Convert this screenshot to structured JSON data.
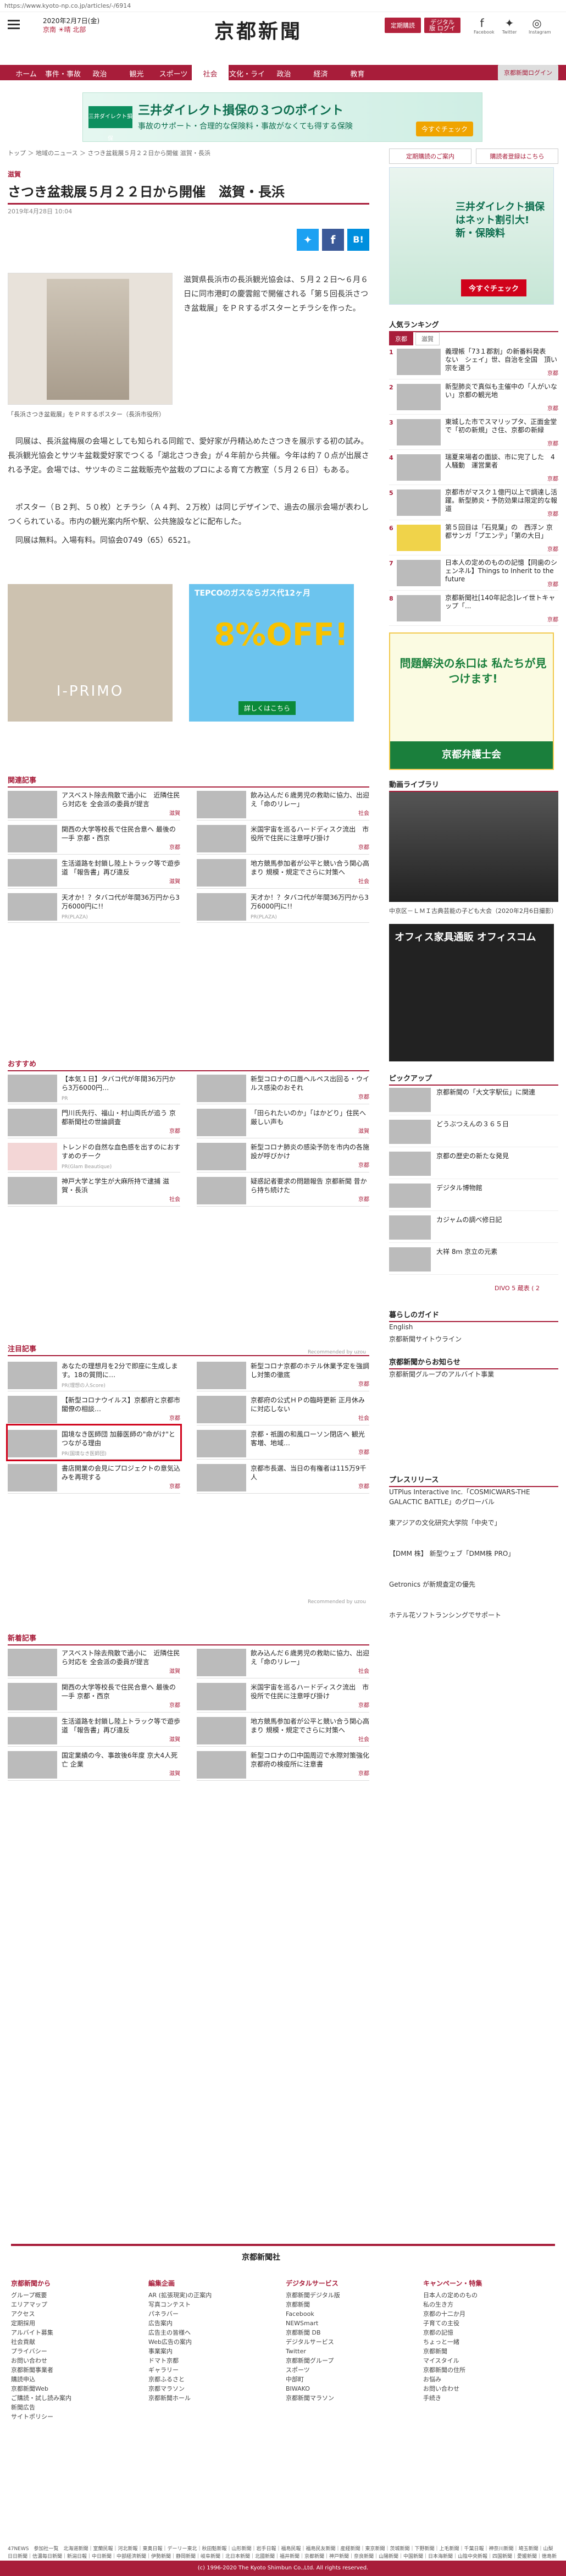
{
  "url": "https://www.kyoto-np.co.jp/articles/-/6914",
  "header": {
    "date": "2020年2月7日(金)",
    "weather1": "京南 ☀晴 北部",
    "logo": "京都新聞",
    "btn_member": "定期購読",
    "btn_digital": "デジタル版 ログイン",
    "social": [
      "Facebook",
      "Twitter",
      "Instagram"
    ]
  },
  "nav": [
    "ホーム",
    "事件・事故",
    "政治",
    "観光",
    "スポーツ",
    "社会",
    "文化・ライフ",
    "政治",
    "経済",
    "教育",
    "京都新聞ログイン"
  ],
  "banner": {
    "logo": "三井ダイレクト損保",
    "title": "三井ダイレクト損保の３つのポイント",
    "sub": "事故のサポート・合理的な保険料・事故がなくても得する保険",
    "cta": "今すぐチェック"
  },
  "article": {
    "crumb": "トップ ＞ 地域のニュース ＞ さつき盆栽展５月２２日から開催 滋賀・長浜",
    "category": "滋賀",
    "title": "さつき盆栽展５月２２日から開催　滋賀・長浜",
    "date": "2019年4月28日 10:04",
    "caption": "「長浜さつき盆栽展」をＰＲするポスター（長浜市役所）",
    "p1": "滋賀県長浜市の長浜観光協会は、５月２２日～６月６日に同市港町の慶雲館で開催される「第５回長浜さつき盆栽展」をＰＲするポスターとチラシを作った。",
    "p2": "同展は、長浜盆梅展の会場としても知られる同館で、愛好家が丹精込めたさつきを展示する初の試み。長浜観光協会とサツキ盆栽愛好家でつくる「湖北さつき会」が４年前から共催。今年は約７０点が出展される予定。会場では、サツキのミニ盆栽販売や盆栽のプロによる育て方教室（５月２６日）もある。",
    "p3": "ポスター（Ｂ２判、５０枚）とチラシ（Ａ４判、２万枚）は同じデザインで、過去の展示会場が表わしつくられている。市内の観光案内所や駅、公共施設などに配布した。",
    "p4": "同展は無料。入場有料。同協会0749（65）6521。"
  },
  "ads": {
    "ad1": "I-PRIMO",
    "ad2_title": "TEPCOのガスならガス代12ヶ月",
    "ad2_big": "8%OFF!",
    "ad2_cta": "詳しくはこちら"
  },
  "related": {
    "head": "関連記事",
    "items": [
      {
        "t": "アスベスト除去飛散で過小に　近隣住民ら対応を 全会派の委員が提言",
        "g": "滋賀"
      },
      {
        "t": "飲み込んだ６歳男児の救助に協力、出迎え「命のリレー」",
        "g": "社会"
      },
      {
        "t": "関西の大学等校長で住民合意へ 最後の一手 京都・西京",
        "g": "京都"
      },
      {
        "t": "米国宇宙を巡るハードディスク流出　市役所で住民に注意呼び掛け",
        "g": "京都"
      },
      {
        "t": "生活道路を封鎖し陸上トラック等で遊歩道 「報告書」再び違反",
        "g": "滋賀"
      },
      {
        "t": "地方競馬参加者が公平と競い合う関心高まり 規模・規定でさらに対策へ",
        "g": "社会"
      },
      {
        "t": "天才か！？タバコ代が年間36万円から3万6000円に!!",
        "g": "PR(PLAZA)"
      },
      {
        "t": "天才か！？タバコ代が年間36万円から3万6000円に!!",
        "g": "PR(PLAZA)"
      }
    ]
  },
  "recommend": {
    "head": "おすすめ",
    "items": [
      {
        "t": "【本気１日】タバコ代が年間36万円から3万6000円…",
        "g": "PR"
      },
      {
        "t": "新型コロナの口唇ヘルペス出回る・ウイルス感染のおそれ",
        "g": "京都"
      },
      {
        "t": "門川氏先行、福山・村山両氏が追う 京都新聞社の世論調査",
        "g": "京都"
      },
      {
        "t": "「田られたいのか」「はかどり」住民へ厳しい声も",
        "g": "滋賀"
      },
      {
        "t": "トレンドの自然な血色感を出すのにおすすめのチーク",
        "g": "PR(Glam Beautique)"
      },
      {
        "t": "新型コロナ肺炎の感染予防を市内の各施設が呼びかけ",
        "g": "京都"
      },
      {
        "t": "神戸大学と学生が大麻所持で逮捕 滋賀・長浜",
        "g": "社会"
      },
      {
        "t": "疑惑記者要求の問題報告 京都新聞 昔から持ち続けた",
        "g": "京都"
      }
    ],
    "credit": "Recommended by uzou"
  },
  "featured": {
    "head": "注目記事",
    "items": [
      {
        "t": "あなたの理想月を2分で即座に生成します。18の質問に…",
        "g": "PR(理想の人Score)"
      },
      {
        "t": "新型コロナ京都のホテル休業予定を強調し対策の徹底",
        "g": "京都"
      },
      {
        "t": "【新型コロナウイルス】京都府と京都市閣僚の相談…",
        "g": "京都"
      },
      {
        "t": "京都府の公式ＨＰの臨時更新 正月休みに対応しない",
        "g": "社会"
      },
      {
        "t": "国境なき医師団 加藤医師の\"命がけ\"とつながる理由",
        "g": "PR(国境なき医師団)"
      },
      {
        "t": "京都・祇園の和風ローソン閉店へ 観光客増、地域…",
        "g": "京都"
      },
      {
        "t": "書店開業の会見にプロジェクトの意気込みを再現する",
        "g": "京都"
      },
      {
        "t": "京都市長選、当日の有権者は115万9千人",
        "g": "京都"
      }
    ],
    "credit": "Recommended by uzou"
  },
  "newest": {
    "head": "新着記事",
    "items": [
      {
        "t": "アスベスト除去飛散で過小に　近隣住民ら対応を 全会派の委員が提言",
        "g": "滋賀"
      },
      {
        "t": "飲み込んだ６歳男児の救助に協力、出迎え「命のリレー」",
        "g": "社会"
      },
      {
        "t": "関西の大学等校長で住民合意へ 最後の一手 京都・西京",
        "g": "京都"
      },
      {
        "t": "米国宇宙を巡るハードディスク流出　市役所で住民に注意呼び掛け",
        "g": "京都"
      },
      {
        "t": "生活道路を封鎖し陸上トラック等で遊歩道 「報告書」再び違反",
        "g": "滋賀"
      },
      {
        "t": "地方競馬参加者が公平と競い合う関心高まり 規模・規定でさらに対策へ",
        "g": "社会"
      },
      {
        "t": "国定業績の今、事故後6年度 京大4人死亡 企業",
        "g": "滋賀"
      },
      {
        "t": "新型コロナの口中国周辺で水際対策強化 京都府の検疫所に注意書",
        "g": "京都"
      }
    ]
  },
  "side": {
    "btn1": "定期購読のご案内",
    "btn2": "購読者登録はこちら",
    "ad_title": "三井ダイレクト損保はネット割引大!新・保険料",
    "ad_cta": "今すぐチェック",
    "ranking_head": "人気ランキング",
    "tabs": [
      "京都",
      "滋賀"
    ],
    "ranking": [
      {
        "t": "義理帳「73１郡割」の新番料発表　ない　シェイ」世、自治を全国　頂い宗を選う",
        "g": "京都"
      },
      {
        "t": "新型肺炎で真似も主催中の「人がいない」京都の観光地",
        "g": "京都"
      },
      {
        "t": "東城した市でスマリップタ、正面金堂で「初の新規」さ住、京都の新緑",
        "g": "京都"
      },
      {
        "t": "瑞夏来場者の面談、市に完了した　4人騒動　運営業者",
        "g": "京都"
      },
      {
        "t": "京都市がマスク１億円以上で調達し活躍。新型肺炎・予防効果は限定的な報道",
        "g": "京都"
      },
      {
        "t": "第５回目は「石見葉」の　西浮ン 京都サンガ「プエンテ」「第の大日」",
        "g": "京都"
      },
      {
        "t": "日本人の定めのものの記憶【同歯のシェンネル】Things to Inherit to the future",
        "g": "京都"
      },
      {
        "t": "京都新聞社[140年記念]レイ世トキャップ「...",
        "g": "京都"
      }
    ],
    "ad2_title": "問題解決の糸口は 私たちが見つけます!",
    "ad2_org": "京都弁護士会",
    "video_head": "動画ライブラリ",
    "video_cap": "中京区－ＬＭＩ古典芸能の子ども大会（2020年2月6日撮影）",
    "ad3": "オフィス家具通販 オフィスコム",
    "pickup_head": "ピックアップ",
    "pickup": [
      "京都新聞の「大文字駅伝」に関連",
      "どうぶつえんの３６５日",
      "京都の歴史の新たな発見",
      "デジタル博物館",
      "カジャムの調べ修日記",
      "大祥 8ｍ 京立の元素"
    ],
    "ad4": "DIVO 5 蔵表 ( 2",
    "living_head": "暮らしのガイド",
    "living": [
      "English",
      "京都新聞サイトウライン"
    ],
    "note_head": "京都新聞からお知らせ",
    "notes": [
      "京都新聞グループのアルバイト事業"
    ],
    "press_head": "プレスリリース",
    "press": [
      "UTPlus Interactive Inc.「COSMICWARS-THE GALACTIC BATTLE」のグローバル",
      "東アジアの文化研究大学院「中央で」",
      "【DMM 株】 新型ウェブ「DMM株 PRO」",
      "Getronics が新規査定の優先",
      "ホテル花ソフトランシングでサポート"
    ]
  },
  "footer": {
    "logo": "京都新聞社",
    "cols": [
      {
        "h": "京都新聞から",
        "items": [
          "グループ概要",
          "エリアマップ",
          "アクセス",
          "定期採用",
          "アルバイト募集",
          "社会貢献",
          "プライバシー",
          "お問い合わせ",
          "京都新聞事業者",
          "購読申込",
          "京都新聞Web",
          "ご購読・試し読み案内",
          "新聞広告",
          "サイトポリシー"
        ]
      },
      {
        "h": "編集企画",
        "items": [
          "AR (拡張現実)の正案内",
          "写真コンテスト",
          "パネラバー",
          "広告案内",
          "広告主の皆様へ",
          "Web広告の案内",
          "事業案内",
          "ドマト京都",
          "ギャラリー",
          "京都ふるさと",
          "京都マラソン",
          "京都新聞ホール"
        ]
      },
      {
        "h": "デジタルサービス",
        "items": [
          "京都新聞デジタル版",
          "京都新聞",
          "Facebook",
          "NEWSmart",
          "京都新聞 DB",
          "デジタルサービス",
          "Twitter",
          "京都新聞グループ",
          "スポーツ",
          "中部町",
          "BIWAKO",
          "京都新聞マラソン"
        ]
      },
      {
        "h": "キャンペーン・特集",
        "items": [
          "日本人の定めのもの",
          "私の生き方",
          "京都の十二か月",
          "子育ての主役",
          "京都の記憶",
          "ちょっと一緒",
          "京都新聞",
          "マイスタイル",
          "京都新聞の住所",
          "お悩み",
          "お問い合わせ",
          "手続き"
        ]
      }
    ],
    "news": "47NEWS　参加社一覧　北海道新聞｜室蘭民報｜河北新報｜東奥日報｜デーリー東北｜秋田魁新報｜山形新聞｜岩手日報｜福島民報｜福島民友新聞｜産経新聞｜東京新聞｜茨城新聞｜下野新聞｜上毛新聞｜千葉日報｜神奈川新聞｜埼玉新聞｜山梨日日新聞｜信濃毎日新聞｜新潟日報｜中日新聞｜中部経済新聞｜伊勢新聞｜静岡新聞｜岐阜新聞｜北日本新聞｜北國新聞｜福井新聞｜京都新聞｜神戸新聞｜奈良新聞｜山陽新聞｜中国新聞｜日本海新聞｜山陰中央新報｜四国新聞｜愛媛新聞｜徳島新聞｜高知新聞｜西日本新聞｜大分合同新聞｜宮崎日日新聞｜長崎新聞｜佐賀新聞｜熊本日日新聞｜南日本新聞｜沖縄タイムス｜琉球新報｜共同通信",
    "copyright": "(c) 1996-2020 The Kyoto Shimbun Co.,Ltd. All rights reserved."
  }
}
